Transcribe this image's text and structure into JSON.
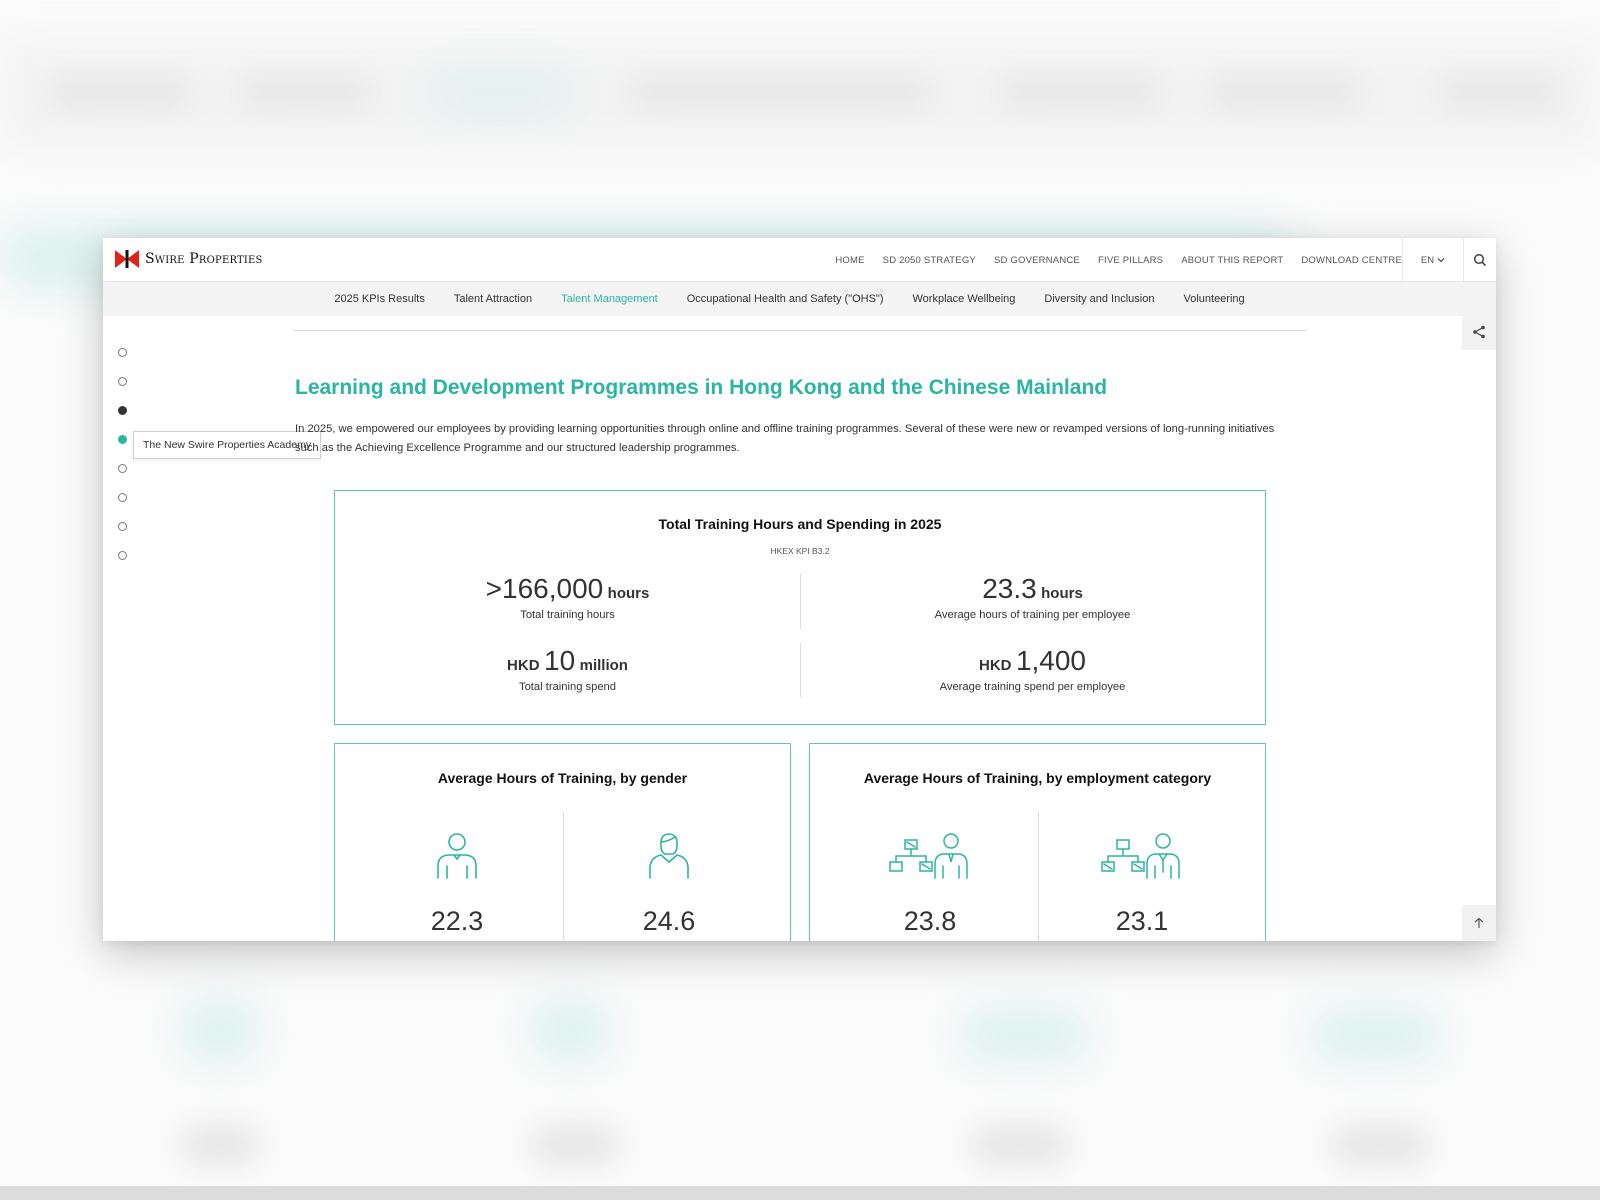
{
  "brand": {
    "logo_text": "Swire Properties",
    "accent": "#2bb5a4",
    "logo_red": "#e2231a"
  },
  "nav": {
    "items": [
      "HOME",
      "SD 2050 STRATEGY",
      "SD GOVERNANCE",
      "FIVE PILLARS",
      "ABOUT THIS REPORT",
      "DOWNLOAD CENTRE"
    ],
    "lang": "EN"
  },
  "subnav": {
    "items": [
      "2025 KPIs Results",
      "Talent Attraction",
      "Talent Management",
      "Occupational Health and Safety (\"OHS\")",
      "Workplace Wellbeing",
      "Diversity and Inclusion",
      "Volunteering"
    ],
    "active": "Talent Management"
  },
  "side_nav": {
    "tooltip": "The New Swire Properties Academy"
  },
  "heading": "Learning and Development Programmes in Hong Kong and the Chinese Mainland",
  "intro": "In 2025, we empowered our employees by providing learning opportunities through online and offline training programmes. Several of these were new or revamped versions of long-running initiatives such as the Achieving Excellence Programme and our structured leadership programmes.",
  "kpi_box": {
    "title": "Total Training Hours and Spending in 2025",
    "subtitle": "HKEX KPI B3.2",
    "items": [
      {
        "prefix": ">",
        "value": "166,000",
        "unit": "hours",
        "label": "Total training hours"
      },
      {
        "prefix": "",
        "value": "23.3",
        "unit": "hours",
        "label": "Average hours of training per employee"
      },
      {
        "prefix": "HKD",
        "value": "10",
        "unit": "million",
        "label": "Total training spend"
      },
      {
        "prefix": "HKD",
        "value": "1,400",
        "unit": "",
        "label": "Average training spend per employee"
      }
    ]
  },
  "gender_box": {
    "title": "Average Hours of Training, by gender",
    "items": [
      {
        "icon": "male-person-icon",
        "value": "22.3"
      },
      {
        "icon": "female-person-icon",
        "value": "24.6"
      }
    ]
  },
  "category_box": {
    "title": "Average Hours of Training, by employment category",
    "items": [
      {
        "icon": "manager-org-chart-icon",
        "value": "23.8"
      },
      {
        "icon": "staff-org-chart-icon",
        "value": "23.1"
      }
    ]
  }
}
